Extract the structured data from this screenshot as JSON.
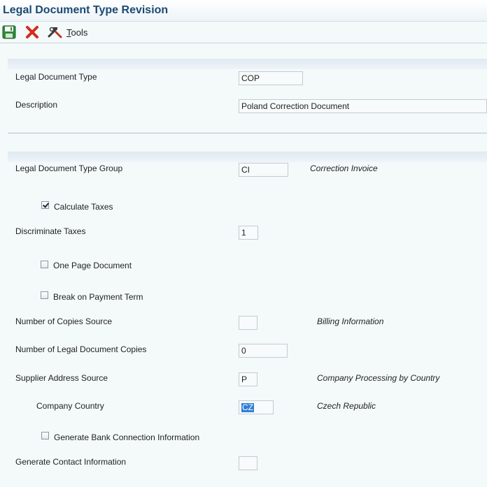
{
  "window": {
    "title": "Legal Document Type Revision"
  },
  "toolbar": {
    "save_icon": "save-icon",
    "cancel_icon": "cancel-icon",
    "tools_icon": "tools-icon",
    "tools_label_first": "T",
    "tools_label_rest": "ools"
  },
  "form": {
    "legal_document_type": {
      "label": "Legal Document Type",
      "value": "COP"
    },
    "description": {
      "label": "Description",
      "value": "Poland Correction Document"
    },
    "legal_document_type_group": {
      "label": "Legal Document Type Group",
      "value": "CI",
      "description": "Correction Invoice"
    },
    "calculate_taxes": {
      "label": "Calculate Taxes",
      "checked": true
    },
    "discriminate_taxes": {
      "label": "Discriminate Taxes",
      "value": "1"
    },
    "one_page_document": {
      "label": "One Page Document",
      "checked": false
    },
    "break_on_payment_term": {
      "label": "Break on Payment Term",
      "checked": false
    },
    "number_of_copies_source": {
      "label": "Number of Copies Source",
      "value": "",
      "description": "Billing Information"
    },
    "number_of_legal_document_copies": {
      "label": "Number of Legal Document Copies",
      "value": "0"
    },
    "supplier_address_source": {
      "label": "Supplier Address Source",
      "value": "P",
      "description": "Company Processing by Country"
    },
    "company_country": {
      "label": "Company Country",
      "value": "CZ",
      "description": "Czech Republic"
    },
    "generate_bank_connection_information": {
      "label": "Generate Bank Connection Information",
      "checked": false
    },
    "generate_contact_information": {
      "label": "Generate Contact Information",
      "value": ""
    }
  },
  "colors": {
    "title": "#1b4a72",
    "selection": "#2f7fd6",
    "cancel_icon": "#d42b1e",
    "save_icon": "#2f8a3a"
  }
}
